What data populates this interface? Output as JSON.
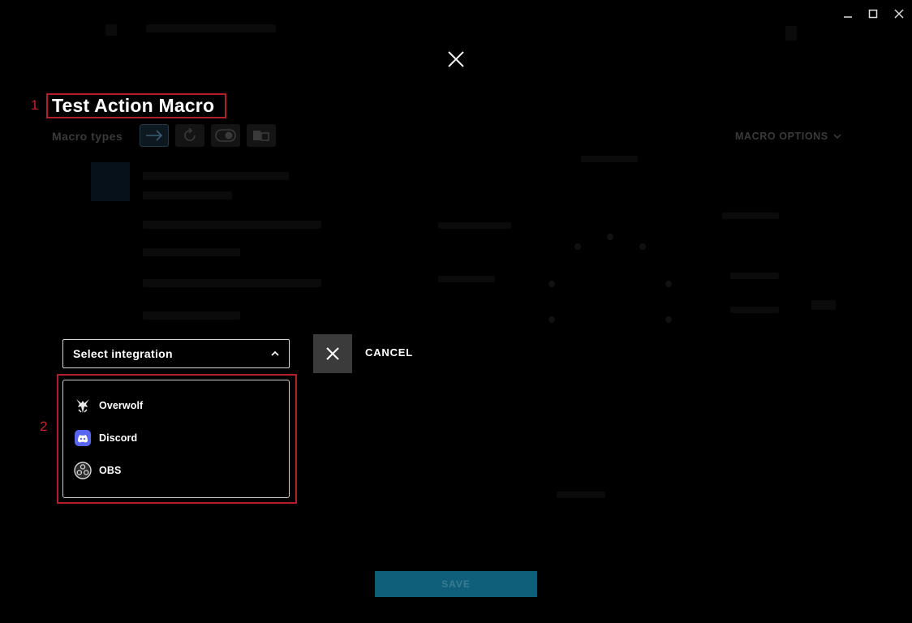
{
  "window": {
    "minimize_icon": "minimize-icon",
    "maximize_icon": "maximize-icon",
    "close_icon": "close-icon"
  },
  "dialog": {
    "close_icon": "close-icon",
    "title": "Test Action Macro",
    "title_marker": "1",
    "macro_types_label": "Macro types",
    "macro_types": [
      {
        "icon": "arrow-right-icon",
        "active": true
      },
      {
        "icon": "repeat-icon",
        "active": false
      },
      {
        "icon": "toggle-icon",
        "active": false
      },
      {
        "icon": "sequence-icon",
        "active": false
      }
    ],
    "macro_options_label": "MACRO OPTIONS"
  },
  "integration": {
    "select_label": "Select integration",
    "cancel_label": "CANCEL",
    "menu_marker": "2",
    "options": [
      {
        "label": "Overwolf",
        "icon": "overwolf-icon"
      },
      {
        "label": "Discord",
        "icon": "discord-icon"
      },
      {
        "label": "OBS",
        "icon": "obs-icon"
      }
    ]
  },
  "footer": {
    "save_label": "SAVE"
  },
  "colors": {
    "background": "#000000",
    "annotation": "#c8202c",
    "save_button": "#0f5f7a",
    "cancel_button": "#3b3b3b",
    "discord": "#5865f2"
  }
}
